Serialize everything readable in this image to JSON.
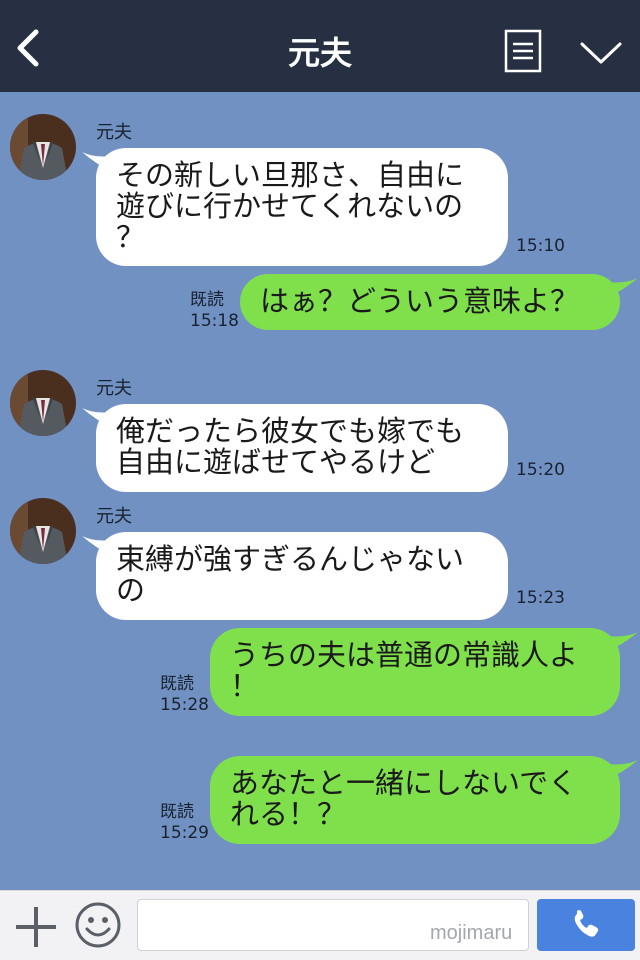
{
  "header": {
    "title": "元夫"
  },
  "messages": [
    {
      "type": "incoming",
      "sender": "元夫",
      "lines": [
        "その新しい旦那さ、自由に",
        "遊びに行かせてくれないの",
        "？"
      ],
      "time": "15:10"
    },
    {
      "type": "outgoing",
      "read_label": "既読",
      "time": "15:18",
      "lines": [
        "はぁ？どういう意味よ？"
      ]
    },
    {
      "type": "incoming",
      "sender": "元夫",
      "lines": [
        "俺だったら彼女でも嫁でも",
        "自由に遊ばせてやるけど"
      ],
      "time": "15:20"
    },
    {
      "type": "incoming",
      "sender": "元夫",
      "lines": [
        "束縛が強すぎるんじゃない",
        "の"
      ],
      "time": "15:23"
    },
    {
      "type": "outgoing",
      "read_label": "既読",
      "time": "15:28",
      "lines": [
        "うちの夫は普通の常識人よ",
        "！"
      ]
    },
    {
      "type": "outgoing",
      "read_label": "既読",
      "time": "15:29",
      "lines": [
        "あなたと一緒にしないでく",
        "れる！？"
      ]
    }
  ],
  "footer": {
    "input_value": "",
    "watermark": "mojimaru"
  },
  "colors": {
    "header_bg": "#263042",
    "chat_bg": "#7091c2",
    "outgoing_bubble": "#80e04c",
    "incoming_bubble": "#ffffff",
    "call_button": "#4a82e0"
  },
  "icons": {
    "back": "chevron-left-icon",
    "menu": "list-icon",
    "collapse": "chevron-down-icon",
    "add": "plus-icon",
    "emoji": "smiley-icon",
    "call": "phone-icon"
  }
}
